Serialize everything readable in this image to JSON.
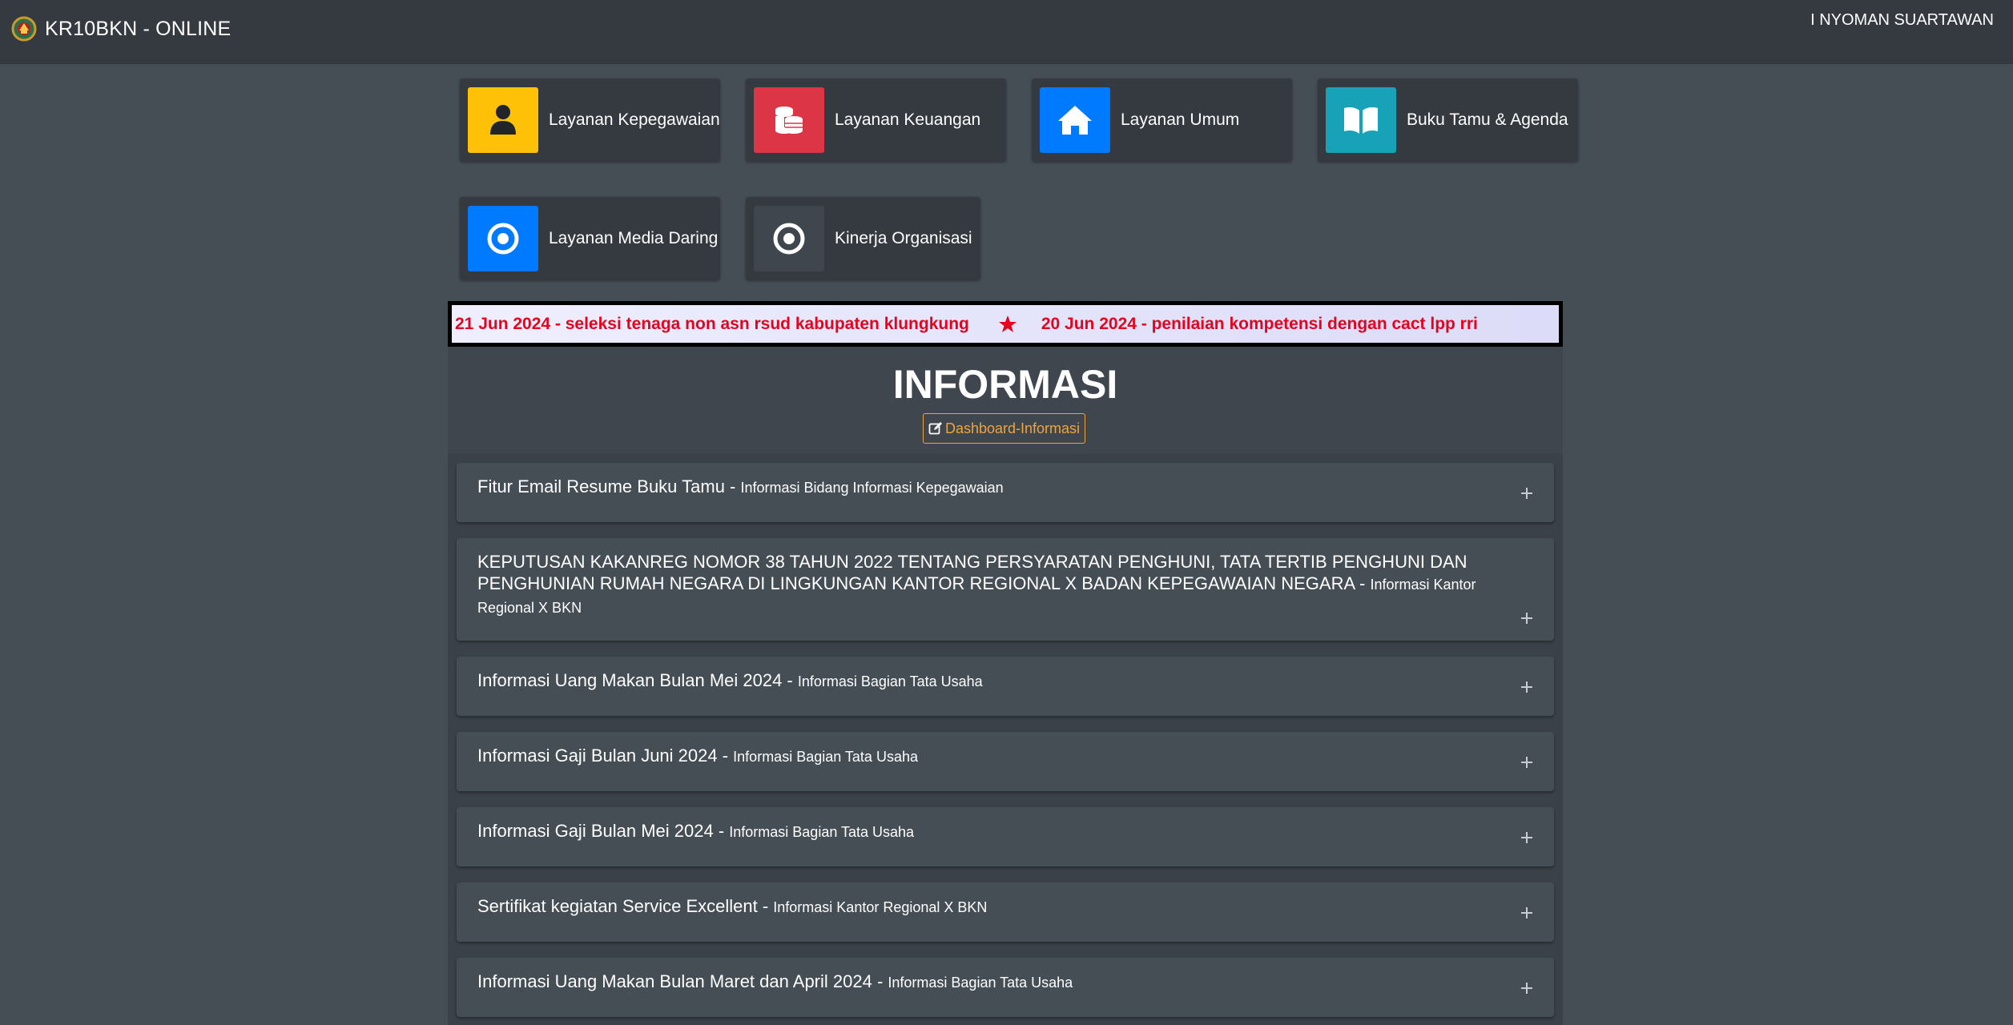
{
  "navbar": {
    "brand": "KR10BKN - ONLINE",
    "user": "I NYOMAN SUARTAWAN"
  },
  "tiles": [
    {
      "label": "Layanan Kepegawaian",
      "icon": "user-icon",
      "color": "#ffc107"
    },
    {
      "label": "Layanan Keuangan",
      "icon": "coins-icon",
      "color": "#dc3545"
    },
    {
      "label": "Layanan Umum",
      "icon": "home-icon",
      "color": "#007bff"
    },
    {
      "label": "Buku Tamu & Agenda",
      "icon": "book-icon",
      "color": "#17a2b8"
    },
    {
      "label": "Layanan Media Daring",
      "icon": "dot-circle-icon",
      "color": "#007bff"
    },
    {
      "label": "Kinerja Organisasi",
      "icon": "dot-circle-icon",
      "color": "#3f464d"
    }
  ],
  "ticker": {
    "items": [
      "21 Jun 2024 - seleksi tenaga non asn rsud kabupaten klungkung",
      "20 Jun 2024 - penilaian kompetensi dengan cact lpp rri"
    ],
    "color": "#e8001c"
  },
  "info": {
    "title": "INFORMASI",
    "dashboard_button": "Dashboard-Informasi",
    "items": [
      {
        "title": "Fitur Email Resume Buku Tamu - ",
        "source": "Informasi Bidang Informasi Kepegawaian"
      },
      {
        "title": "KEPUTUSAN KAKANREG NOMOR 38 TAHUN 2022 TENTANG PERSYARATAN PENGHUNI, TATA TERTIB PENGHUNI DAN PENGHUNIAN RUMAH NEGARA DI LINGKUNGAN KANTOR REGIONAL X BADAN KEPEGAWAIAN NEGARA - ",
        "source": "Informasi Kantor Regional X BKN"
      },
      {
        "title": "Informasi Uang Makan Bulan Mei 2024 - ",
        "source": "Informasi Bagian Tata Usaha"
      },
      {
        "title": "Informasi Gaji Bulan Juni 2024 - ",
        "source": "Informasi Bagian Tata Usaha"
      },
      {
        "title": "Informasi Gaji Bulan Mei 2024 - ",
        "source": "Informasi Bagian Tata Usaha"
      },
      {
        "title": "Sertifikat kegiatan Service Excellent - ",
        "source": "Informasi Kantor Regional X BKN"
      },
      {
        "title": "Informasi Uang Makan Bulan Maret dan April 2024 - ",
        "source": "Informasi Bagian Tata Usaha"
      }
    ]
  }
}
